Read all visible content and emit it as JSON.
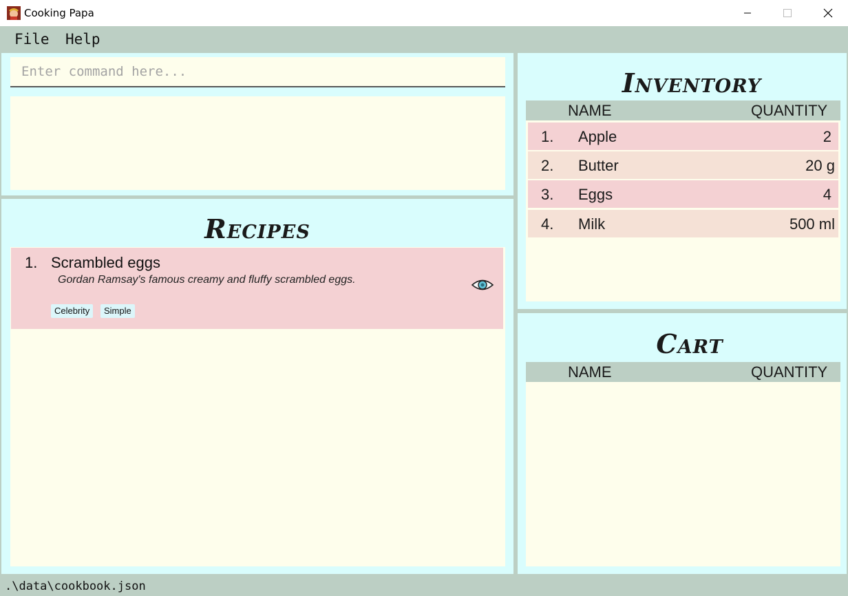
{
  "window": {
    "title": "Cooking Papa",
    "icon": "chef-avatar-icon"
  },
  "menu": {
    "items": [
      {
        "label": "File"
      },
      {
        "label": "Help"
      }
    ]
  },
  "command": {
    "placeholder": "Enter command here...",
    "value": "",
    "result": ""
  },
  "recipes": {
    "heading": "Recipes",
    "items": [
      {
        "index": "1.",
        "name": "Scrambled eggs",
        "description": "Gordan Ramsay's famous creamy and fluffy scrambled eggs.",
        "tags": [
          "Celebrity",
          "Simple"
        ],
        "view_icon": "eye-icon"
      }
    ]
  },
  "inventory": {
    "heading": "Inventory",
    "columns": [
      "NAME",
      "QUANTITY"
    ],
    "rows": [
      {
        "index": "1.",
        "name": "Apple",
        "quantity": "2"
      },
      {
        "index": "2.",
        "name": "Butter",
        "quantity": "20 g"
      },
      {
        "index": "3.",
        "name": "Eggs",
        "quantity": "4"
      },
      {
        "index": "4.",
        "name": "Milk",
        "quantity": "500 ml"
      }
    ]
  },
  "cart": {
    "heading": "Cart",
    "columns": [
      "NAME",
      "QUANTITY"
    ],
    "rows": []
  },
  "status": {
    "path": ".\\data\\cookbook.json"
  },
  "colors": {
    "frame": "#bccfc4",
    "panel": "#d9fdfd",
    "cream": "#fefeec",
    "row_pink": "#f4d1d3",
    "row_peach": "#f5e1d6",
    "tag": "#dcf6fa"
  }
}
